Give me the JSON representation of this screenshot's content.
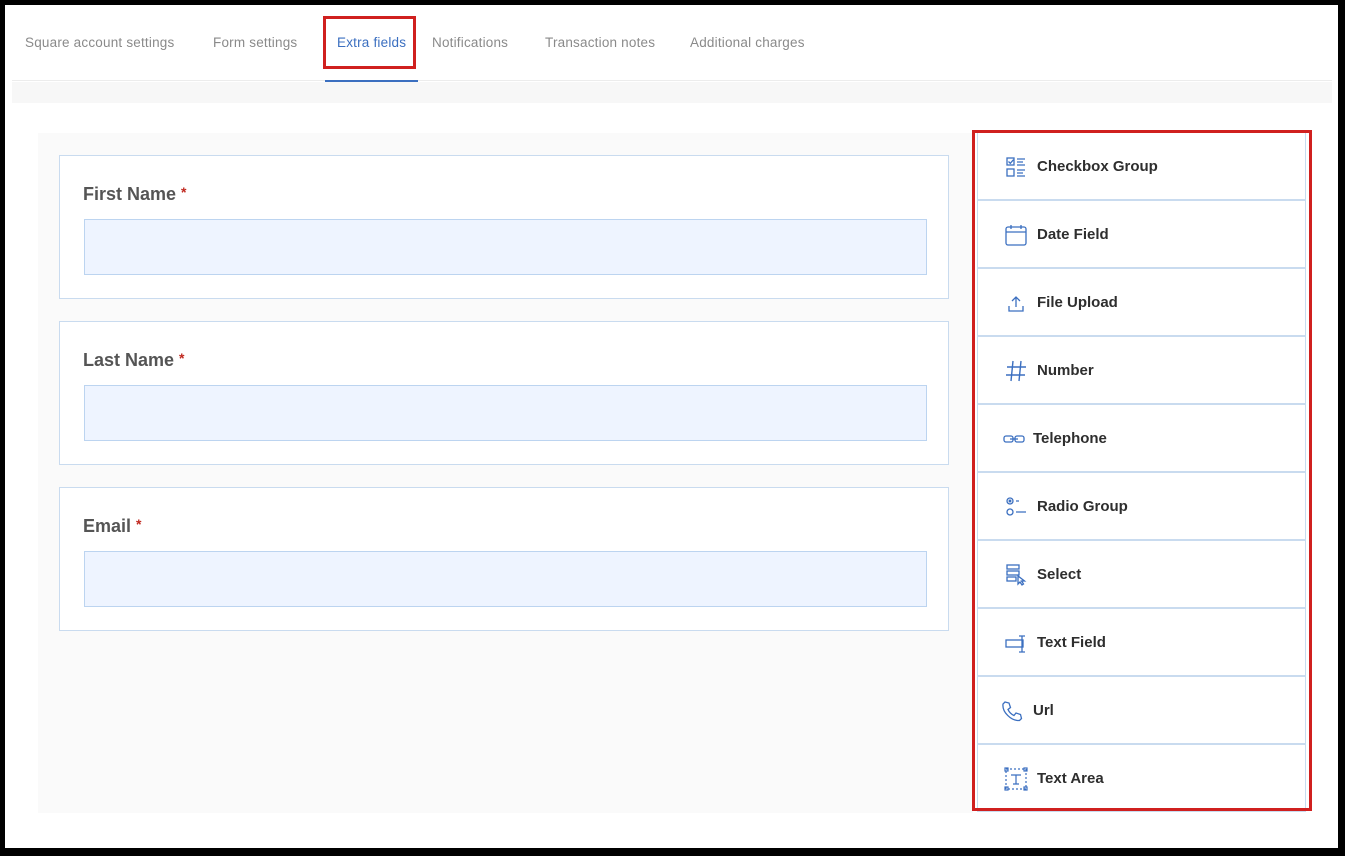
{
  "tabs": [
    {
      "label": "Square account settings",
      "active": false
    },
    {
      "label": "Form settings",
      "active": false
    },
    {
      "label": "Extra fields",
      "active": true
    },
    {
      "label": "Notifications",
      "active": false
    },
    {
      "label": "Transaction notes",
      "active": false
    },
    {
      "label": "Additional charges",
      "active": false
    }
  ],
  "form_fields": [
    {
      "label": "First Name",
      "required_mark": "*",
      "value": ""
    },
    {
      "label": "Last Name",
      "required_mark": "*",
      "value": ""
    },
    {
      "label": "Email",
      "required_mark": "*",
      "value": ""
    }
  ],
  "palette": [
    {
      "label": "Checkbox Group",
      "icon": "checkbox-group-icon"
    },
    {
      "label": "Date Field",
      "icon": "calendar-icon"
    },
    {
      "label": "File Upload",
      "icon": "upload-icon"
    },
    {
      "label": "Number",
      "icon": "hash-icon"
    },
    {
      "label": "Telephone",
      "icon": "link-icon"
    },
    {
      "label": "Radio Group",
      "icon": "radio-group-icon"
    },
    {
      "label": "Select",
      "icon": "select-icon"
    },
    {
      "label": "Text Field",
      "icon": "text-field-icon"
    },
    {
      "label": "Url",
      "icon": "phone-icon"
    },
    {
      "label": "Text Area",
      "icon": "text-area-icon"
    }
  ],
  "colors": {
    "accent": "#3b6fc0",
    "highlight": "#d0201f",
    "icon": "#3b6fc0",
    "input_bg": "#eef4ff",
    "border": "#c9dbef"
  }
}
